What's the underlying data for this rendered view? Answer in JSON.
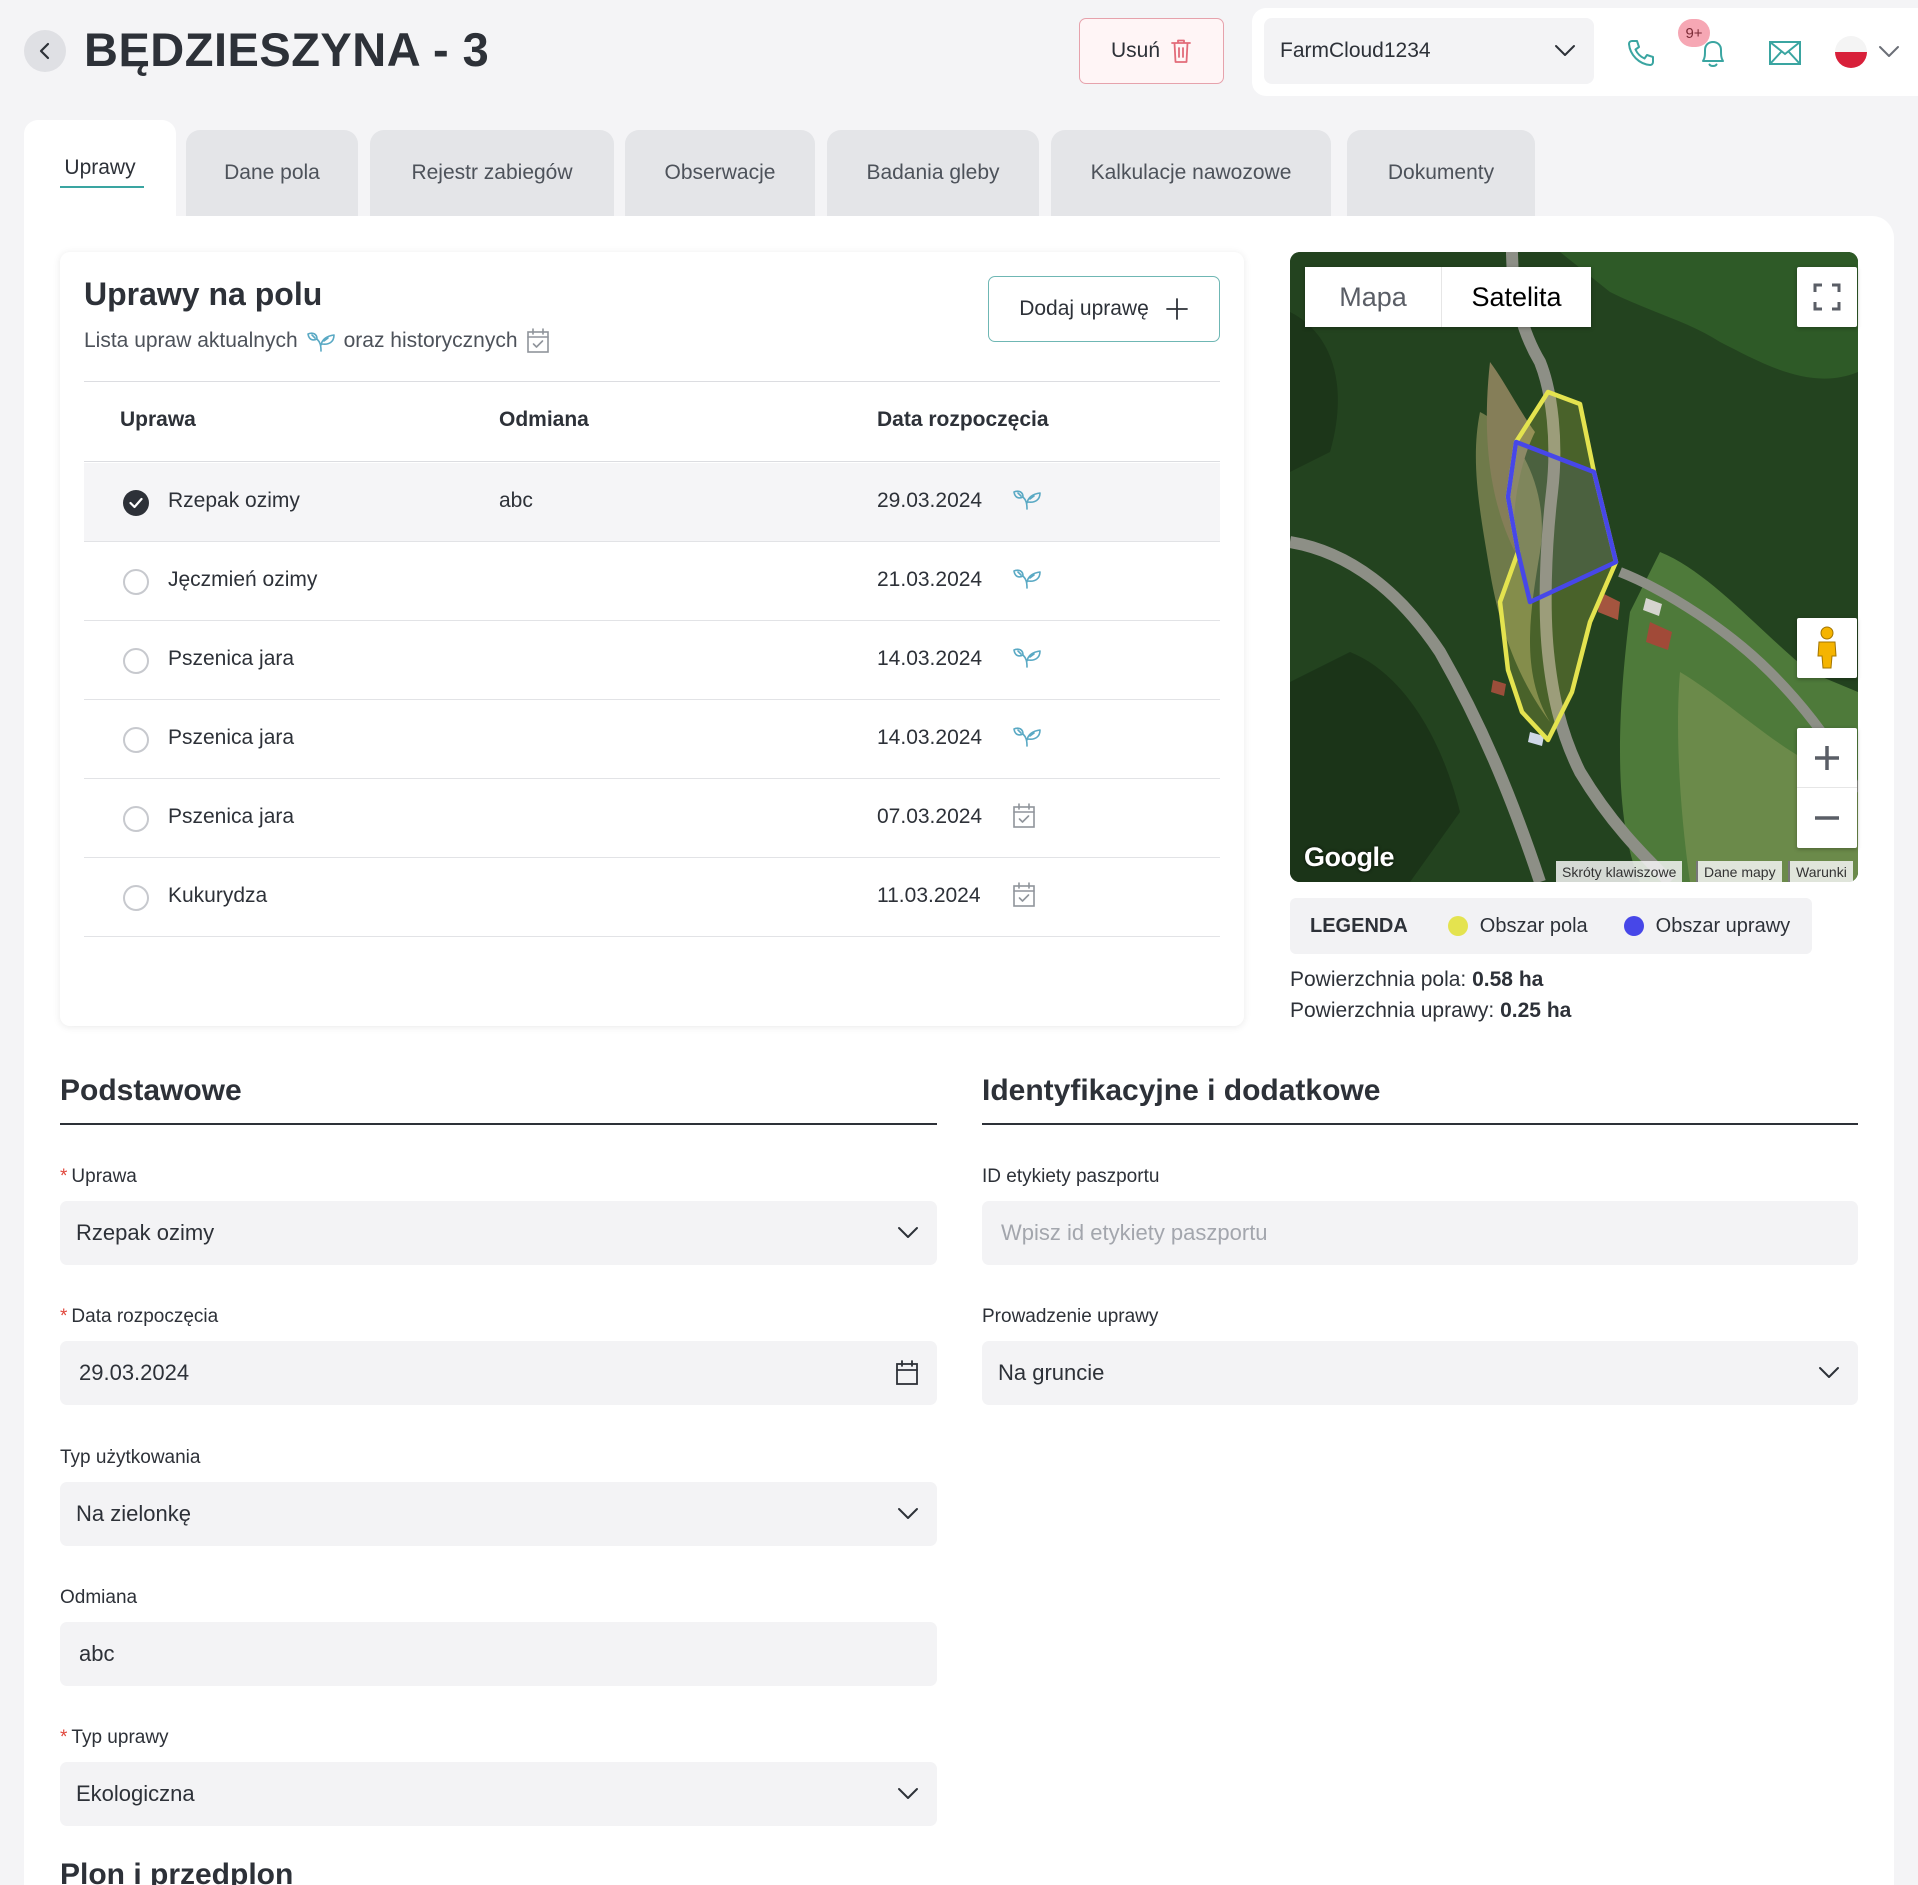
{
  "header": {
    "title": "BĘDZIESZYNA - 3",
    "delete_label": "Usuń",
    "account": "FarmCloud1234",
    "notification_count": "9+"
  },
  "tabs": [
    "Uprawy",
    "Dane pola",
    "Rejestr zabiegów",
    "Obserwacje",
    "Badania gleby",
    "Kalkulacje nawozowe",
    "Dokumenty"
  ],
  "crops_card": {
    "title": "Uprawy na polu",
    "subtitle_part1": "Lista upraw aktualnych",
    "subtitle_part2": "oraz historycznych",
    "add_label": "Dodaj uprawę",
    "columns": [
      "Uprawa",
      "Odmiana",
      "Data rozpoczęcia"
    ],
    "rows": [
      {
        "name": "Rzepak ozimy",
        "variety": "abc",
        "date": "29.03.2024",
        "icon": "sprout-icon",
        "selected": true
      },
      {
        "name": "Jęczmień ozimy",
        "variety": "",
        "date": "21.03.2024",
        "icon": "sprout-icon",
        "selected": false
      },
      {
        "name": "Pszenica jara",
        "variety": "",
        "date": "14.03.2024",
        "icon": "sprout-icon",
        "selected": false
      },
      {
        "name": "Pszenica jara",
        "variety": "",
        "date": "14.03.2024",
        "icon": "sprout-icon",
        "selected": false
      },
      {
        "name": "Pszenica jara",
        "variety": "",
        "date": "07.03.2024",
        "icon": "calendar-check-icon",
        "selected": false
      },
      {
        "name": "Kukurydza",
        "variety": "",
        "date": "11.03.2024",
        "icon": "calendar-check-icon",
        "selected": false
      }
    ]
  },
  "map": {
    "tab_map": "Mapa",
    "tab_satellite": "Satelita",
    "active_tab": "Satelita",
    "brand": "Google",
    "attribution": [
      "Skróty klawiszowe",
      "Dane mapy",
      "Warunki"
    ]
  },
  "legend": {
    "title": "LEGENDA",
    "field_area": "Obszar pola",
    "crop_area": "Obszar uprawy",
    "field_color": "#e4e34f",
    "crop_color": "#4747e8"
  },
  "areas": {
    "field_label": "Powierzchnia pola:",
    "field_value": "0.58 ha",
    "crop_label": "Powierzchnia uprawy:",
    "crop_value": "0.25 ha"
  },
  "basic": {
    "title": "Podstawowe",
    "crop_label": "Uprawa",
    "crop_value": "Rzepak ozimy",
    "start_label": "Data rozpoczęcia",
    "start_value": "29.03.2024",
    "usage_label": "Typ użytkowania",
    "usage_value": "Na zielonkę",
    "variety_label": "Odmiana",
    "variety_value": "abc",
    "type_label": "Typ uprawy",
    "type_value": "Ekologiczna"
  },
  "ident": {
    "title": "Identyfikacyjne i dodatkowe",
    "passport_label": "ID etykiety paszportu",
    "passport_placeholder": "Wpisz id etykiety paszportu",
    "cultivation_label": "Prowadzenie uprawy",
    "cultivation_value": "Na gruncie"
  },
  "next_section": "Plon i przedplon",
  "colors": {
    "accent": "#3aa5a1",
    "danger": "#e0473c",
    "text": "#2d3138"
  }
}
